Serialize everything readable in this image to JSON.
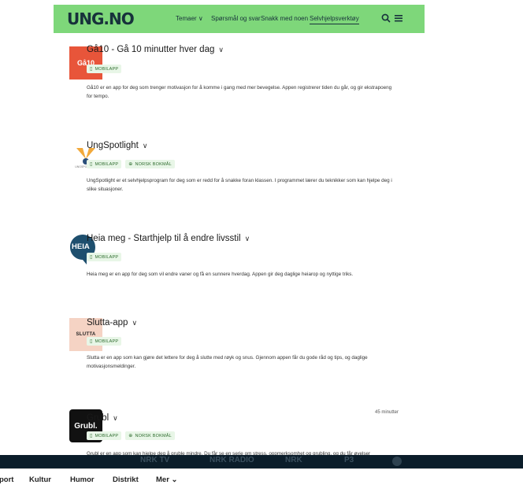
{
  "header": {
    "logo": "UNG.NO",
    "nav": [
      {
        "label": "Temaer ∨"
      },
      {
        "label": "Spørsmål og svar"
      },
      {
        "label": "Snakk med noen"
      },
      {
        "label": "Selvhjelpsverktøy"
      }
    ],
    "search_icon": "search-icon",
    "menu_icon": "menu-icon"
  },
  "apps": [
    {
      "title": "Gå10 - Gå 10 minutter hver dag",
      "logo_text": "Gå10",
      "logo_color": "#e8553a",
      "tags": [
        "MOBILAPP"
      ],
      "description": "Gå10 er en app for deg som trenger motivasjon for å komme i gang med mer bevegelse. Appen registrerer tiden du går, og gir ekstrapoeng for tempo."
    },
    {
      "title": "UngSpotlight",
      "logo_text": "UNGSPOTLIGHT",
      "logo_color": "#f2a93b",
      "tags": [
        "MOBILAPP",
        "NORSK BOKMÅL"
      ],
      "description": "UngSpotlight er et selvhjelpsprogram for deg som er redd for å snakke foran klassen. I programmet lærer du teknikker som kan hjelpe deg i slike situasjoner."
    },
    {
      "title": "Heia meg - Starthjelp til å endre livsstil",
      "logo_text": "HEIA",
      "logo_color": "#1e4f6e",
      "tags": [
        "MOBILAPP"
      ],
      "description": "Heia meg er en app for deg som vil endre vaner og få en sunnere hverdag. Appen gir deg daglige heiarop og nyttige triks."
    },
    {
      "title": "Slutta-app",
      "logo_text": "SLUTTA",
      "logo_color": "#f5d3c4",
      "tags": [
        "MOBILAPP"
      ],
      "description": "Slutta er en app som kan gjøre det lettere for deg å slutte med røyk og snus. Gjennom appen får du gode råd og tips, og daglige motivasjonsmeldinger."
    },
    {
      "title": "Grubl",
      "logo_text": "Grubl.",
      "logo_color": "#111111",
      "tags": [
        "MOBILAPP",
        "NORSK BOKMÅL"
      ],
      "meta": "45 minutter",
      "description": "Grubl er en app som kan hjelpe deg å gruble mindre. Du får se en serie om stress, oppmerksomhet og grubling, og du får øvelser"
    }
  ],
  "overlay_bar": {
    "items": [
      "NRK TV",
      "NRK RADIO",
      "NRK",
      "P3"
    ]
  },
  "bottom_nav": {
    "items": [
      "port",
      "Kultur",
      "Humor",
      "Distrikt",
      "Mer ⌄"
    ]
  },
  "colors": {
    "header_green": "#7ed77a",
    "tag_bg": "#e8f6e7",
    "dark_bar": "#0b1d2a"
  }
}
